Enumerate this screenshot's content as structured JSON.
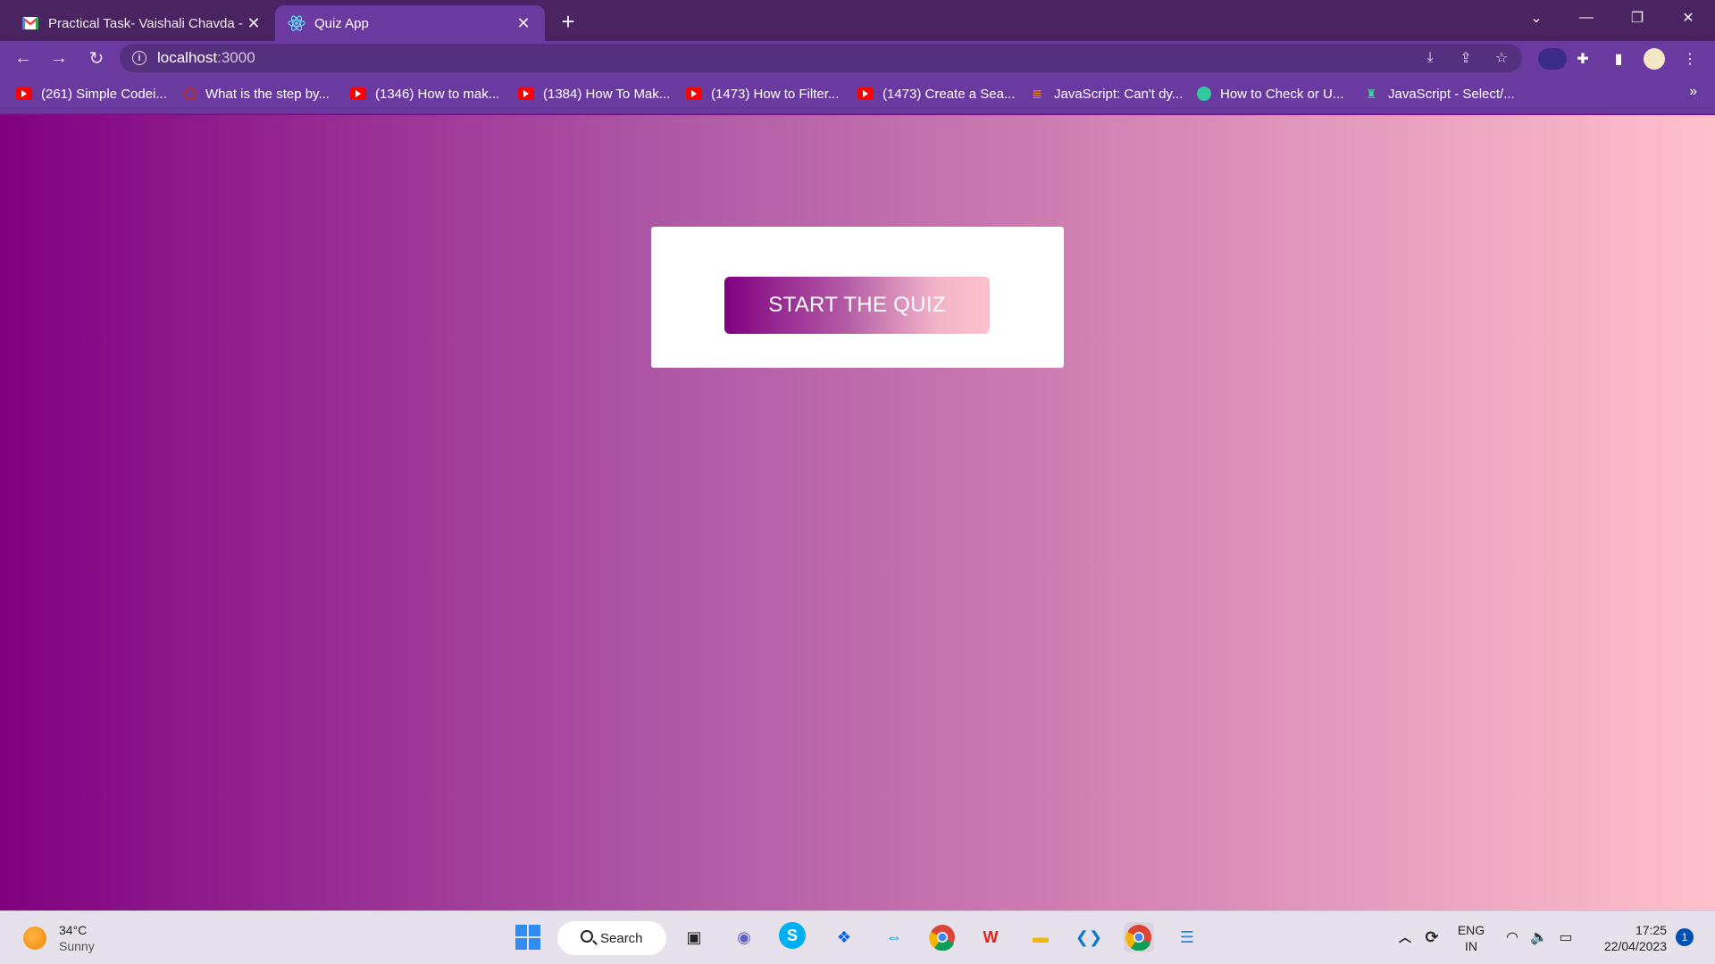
{
  "browser": {
    "tabs": [
      {
        "title": "Practical Task- Vaishali Chavda - V",
        "icon": "gmail-icon",
        "active": false
      },
      {
        "title": "Quiz App",
        "icon": "react-icon",
        "active": true
      }
    ],
    "address": {
      "host": "localhost",
      "port": ":3000"
    },
    "bookmarks": [
      {
        "label": "(261) Simple Codei...",
        "icon": "youtube-icon"
      },
      {
        "label": "What is the step by...",
        "icon": "quora-icon"
      },
      {
        "label": "(1346) How to mak...",
        "icon": "youtube-icon"
      },
      {
        "label": "(1384) How To Mak...",
        "icon": "youtube-icon"
      },
      {
        "label": "(1473) How to Filter...",
        "icon": "youtube-icon"
      },
      {
        "label": "(1473) Create a Sea...",
        "icon": "youtube-icon"
      },
      {
        "label": "JavaScript: Can't dy...",
        "icon": "stackoverflow-icon"
      },
      {
        "label": "How to Check or U...",
        "icon": "site-icon"
      },
      {
        "label": "JavaScript - Select/...",
        "icon": "site-icon"
      }
    ],
    "bookmarks_more": "»"
  },
  "page": {
    "start_button": "START THE QUIZ",
    "colors": {
      "gradient_start": "#800080",
      "gradient_end": "#ffc0cb"
    }
  },
  "taskbar": {
    "weather_temp": "34°C",
    "weather_cond": "Sunny",
    "search_label": "Search",
    "lang_top": "ENG",
    "lang_bottom": "IN",
    "time": "17:25",
    "date": "22/04/2023",
    "notifications": "1"
  }
}
